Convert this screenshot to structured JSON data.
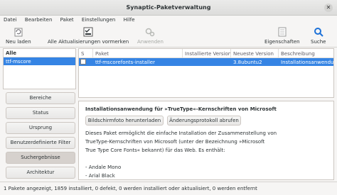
{
  "window": {
    "title": "Synaptic-Paketverwaltung"
  },
  "menu": [
    "Datei",
    "Bearbeiten",
    "Paket",
    "Einstellungen",
    "Hilfe"
  ],
  "toolbar": {
    "reload": "Neu laden",
    "mark_all": "Alle Aktualisierungen vormerken",
    "apply": "Anwenden",
    "properties": "Eigenschaften",
    "search": "Suche"
  },
  "filters": {
    "header": "Alle",
    "items": [
      "ttf-mscore"
    ]
  },
  "left_buttons": [
    "Bereiche",
    "Status",
    "Ursprung",
    "Benutzerdefinierte Filter",
    "Suchergebnisse",
    "Architektur"
  ],
  "left_active": "Suchergebnisse",
  "table": {
    "columns": [
      "S",
      "Paket",
      "Installierte Version",
      "Neueste Version",
      "Beschreibung"
    ],
    "rows": [
      {
        "paket": "ttf-mscorefonts-installer",
        "installed": "",
        "latest": "3.8ubuntu2",
        "description": "Installationsanwendung"
      }
    ]
  },
  "detail": {
    "title": "Installationsanwendung für »TrueType«-Kernschriften von Microsoft",
    "screenshot_button": "Bildschirmfoto herunterladen",
    "changelog_button": "Änderungsprotokoll abrufen",
    "lines": [
      "Dieses Paket ermöglicht die einfache Installation der Zusammenstellung von",
      "TrueType-Kernschriften von Microsoft (unter der Bezeichnung »Microsoft",
      "True Type Core Fonts« bekannt) für das Web. Es enthält:",
      "",
      " - Andale Mono",
      " - Arial Black"
    ]
  },
  "status": "1 Pakete angezeigt, 1859 installiert, 0 defekt, 0 werden installiert oder aktualisiert, 0 werden entfernt",
  "colors": {
    "selection": "#3584e4",
    "accent_icon": "#1c71d8"
  }
}
